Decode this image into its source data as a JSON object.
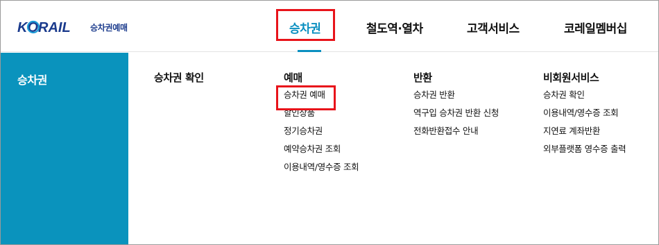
{
  "brand": {
    "logo_text": "KORAIL",
    "sub_title": "승차권예매"
  },
  "gnb": [
    {
      "label": "승차권",
      "active": true
    },
    {
      "label": "철도역·열차",
      "active": false
    },
    {
      "label": "고객서비스",
      "active": false
    },
    {
      "label": "코레일멤버십",
      "active": false
    }
  ],
  "side": {
    "title": "승차권"
  },
  "menu": {
    "col1": {
      "head": "승차권 확인",
      "items": []
    },
    "col2": {
      "head": "예매",
      "items": [
        "승차권 예매",
        "할인상품",
        "정기승차권",
        "예약승차권 조회",
        "이용내역/영수증 조회"
      ]
    },
    "col3": {
      "head": "반환",
      "items": [
        "승차권 반환",
        "역구입 승차권 반환 신청",
        "전화반환접수 안내"
      ]
    },
    "col4": {
      "head": "비회원서비스",
      "items": [
        "승차권 확인",
        "이용내역/영수증 조회",
        "지연료 계좌반환",
        "외부플랫폼 영수증 출력"
      ]
    }
  },
  "colors": {
    "accent": "#0a8fc0",
    "side_bg": "#0a93bd",
    "highlight": "#e8131a",
    "brand_blue": "#1a3a8c"
  }
}
